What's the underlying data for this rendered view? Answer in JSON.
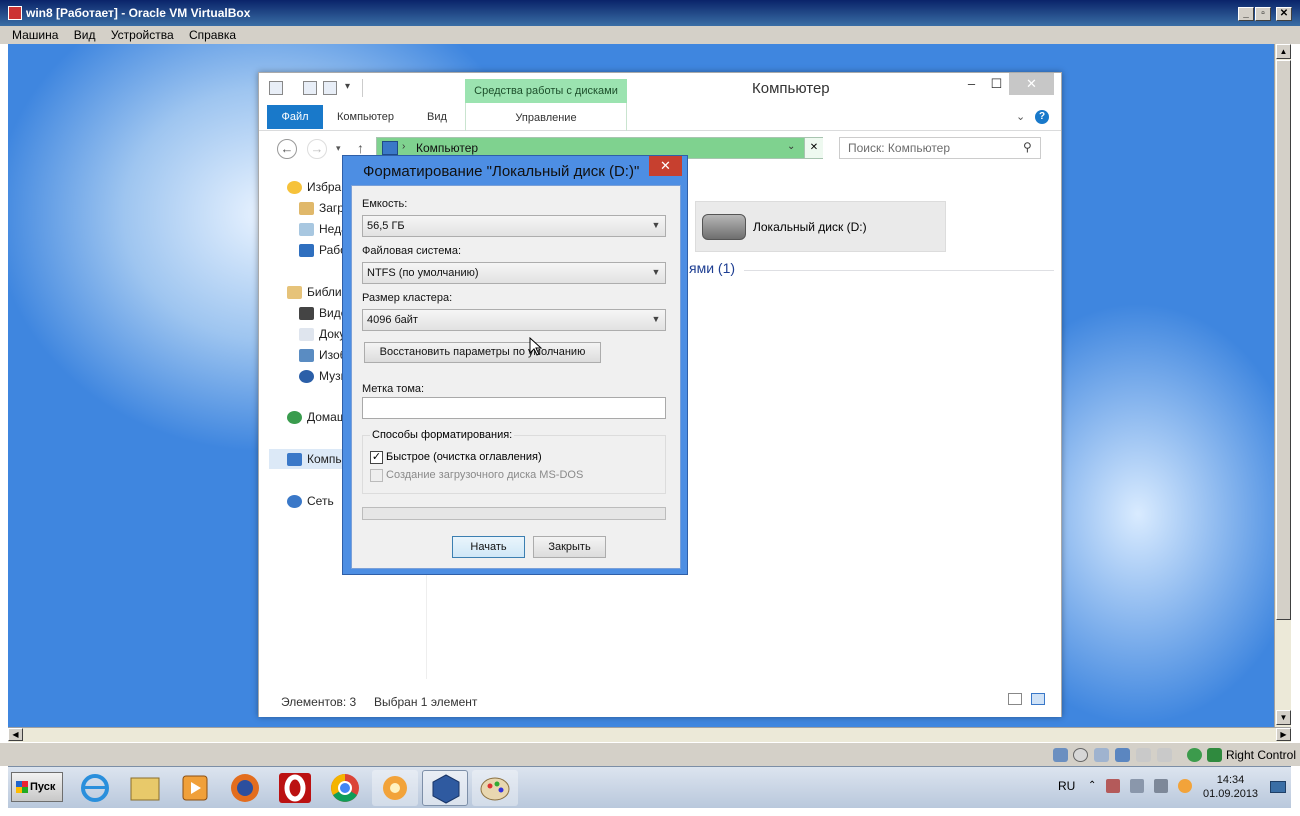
{
  "vbox": {
    "title": "win8 [Работает] - Oracle VM VirtualBox",
    "menu": [
      "Машина",
      "Вид",
      "Устройства",
      "Справка"
    ],
    "host_key": "Right Control"
  },
  "explorer": {
    "title": "Компьютер",
    "context_tab_group": "Средства работы с дисками",
    "tabs": {
      "file": "Файл",
      "computer": "Компьютер",
      "view": "Вид",
      "manage": "Управление"
    },
    "address": "Компьютер",
    "search_placeholder": "Поиск: Компьютер",
    "nav": [
      {
        "label": "Избра",
        "icon": "star-icon"
      },
      {
        "label": "Загр",
        "icon": "downloads-icon"
      },
      {
        "label": "Неда",
        "icon": "recent-places-icon"
      },
      {
        "label": "Рабо",
        "icon": "desktop-icon"
      },
      {
        "label": "Библи",
        "icon": "libraries-icon"
      },
      {
        "label": "Виде",
        "icon": "videos-icon"
      },
      {
        "label": "Доку",
        "icon": "documents-icon"
      },
      {
        "label": "Изоб",
        "icon": "pictures-icon"
      },
      {
        "label": "Музы",
        "icon": "music-icon"
      },
      {
        "label": "Домаш",
        "icon": "homegroup-icon"
      },
      {
        "label": "Компь",
        "icon": "computer-icon"
      },
      {
        "label": "Сеть",
        "icon": "network-icon"
      }
    ],
    "drive_name": "Локальный диск (D:)",
    "group_partial": "ями (1)",
    "status_items": "Элементов: 3",
    "status_selected": "Выбран 1 элемент"
  },
  "dialog": {
    "title": "Форматирование \"Локальный диск (D:)\"",
    "capacity_label": "Емкость:",
    "capacity_value": "56,5 ГБ",
    "fs_label": "Файловая система:",
    "fs_value": "NTFS (по умолчанию)",
    "cluster_label": "Размер кластера:",
    "cluster_value": "4096 байт",
    "restore_button": "Восстановить параметры по умолчанию",
    "volume_label": "Метка тома:",
    "volume_value": "",
    "options_legend": "Способы форматирования:",
    "quick_format": "Быстрое (очистка оглавления)",
    "quick_format_checked": true,
    "msdos_boot": "Создание загрузочного диска MS-DOS",
    "msdos_boot_enabled": false,
    "start_button": "Начать",
    "close_button": "Закрыть"
  },
  "taskbar": {
    "start_label": "Пуск",
    "apps": [
      "internet-explorer-icon",
      "file-manager-icon",
      "media-player-icon",
      "firefox-icon",
      "opera-icon",
      "chrome-icon",
      "flower-app-icon",
      "virtualbox-icon",
      "paint-icon"
    ],
    "lang": "RU",
    "time": "14:34",
    "date": "01.09.2013"
  }
}
